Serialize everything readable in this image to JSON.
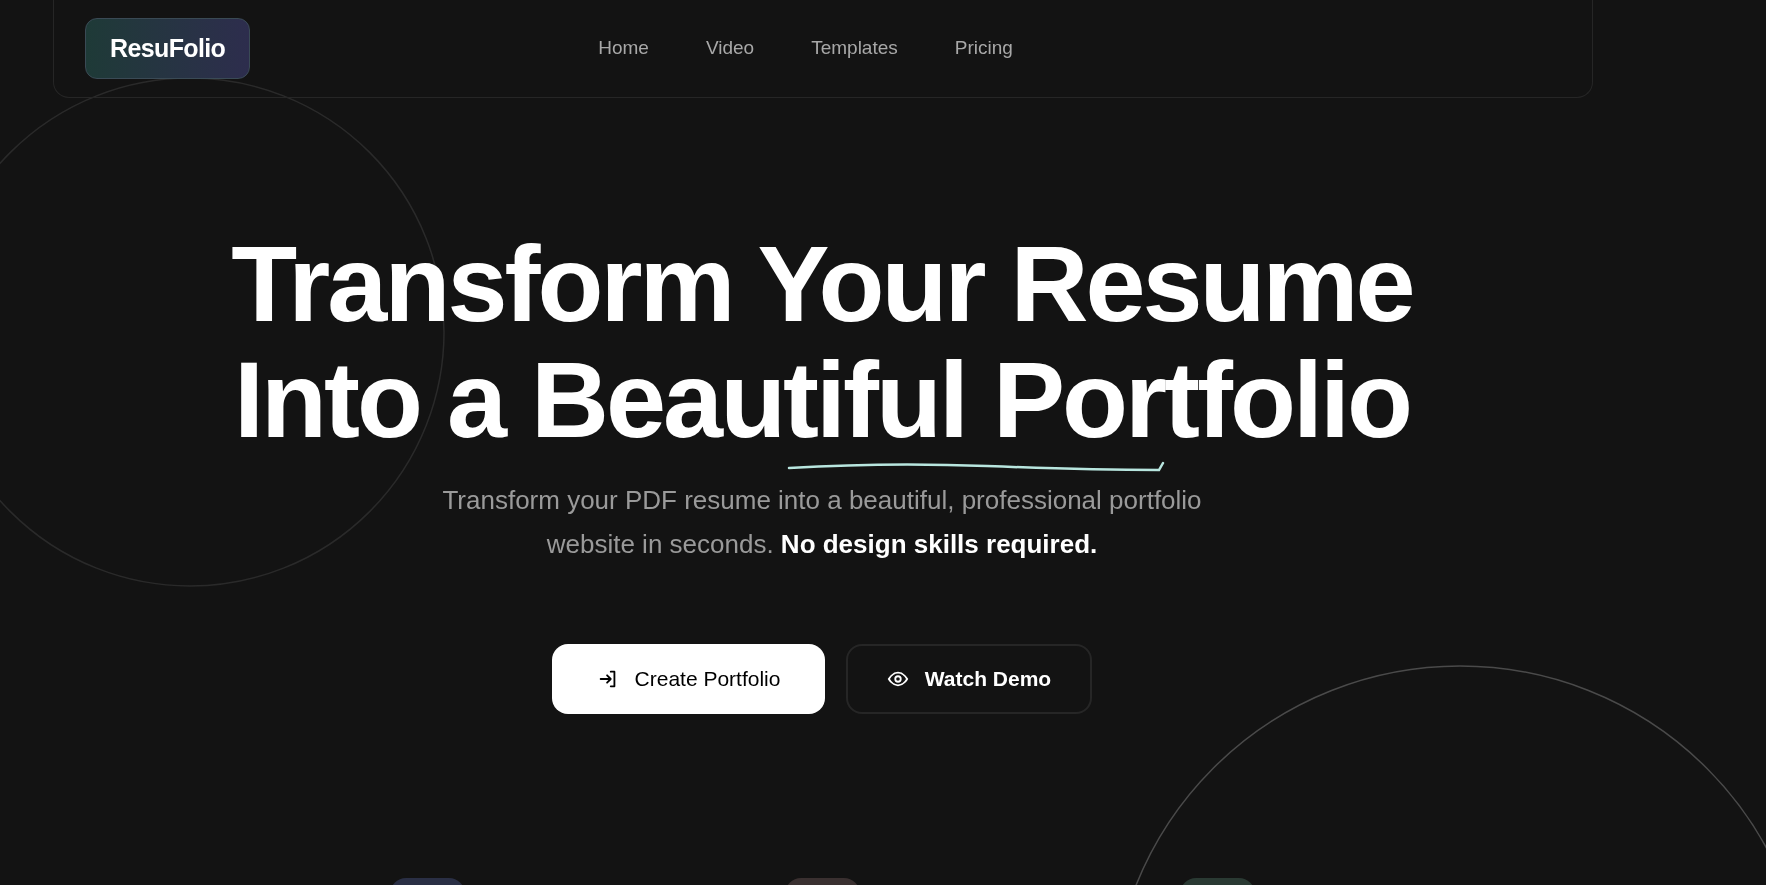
{
  "nav": {
    "logo": "ResuFolio",
    "links": [
      {
        "label": "Home"
      },
      {
        "label": "Video"
      },
      {
        "label": "Templates"
      },
      {
        "label": "Pricing"
      }
    ]
  },
  "hero": {
    "title_lines": [
      "Transform Your Resume",
      "Into a Beautiful Portfolio"
    ],
    "subtitle": "Transform your PDF resume into a beautiful, professional portfolio website in seconds. **No design skills required.**",
    "buttons": [
      {
        "label": "Create Portfolio",
        "kind": "primary"
      },
      {
        "label": "Watch Demo",
        "kind": "secondary"
      }
    ]
  }
}
